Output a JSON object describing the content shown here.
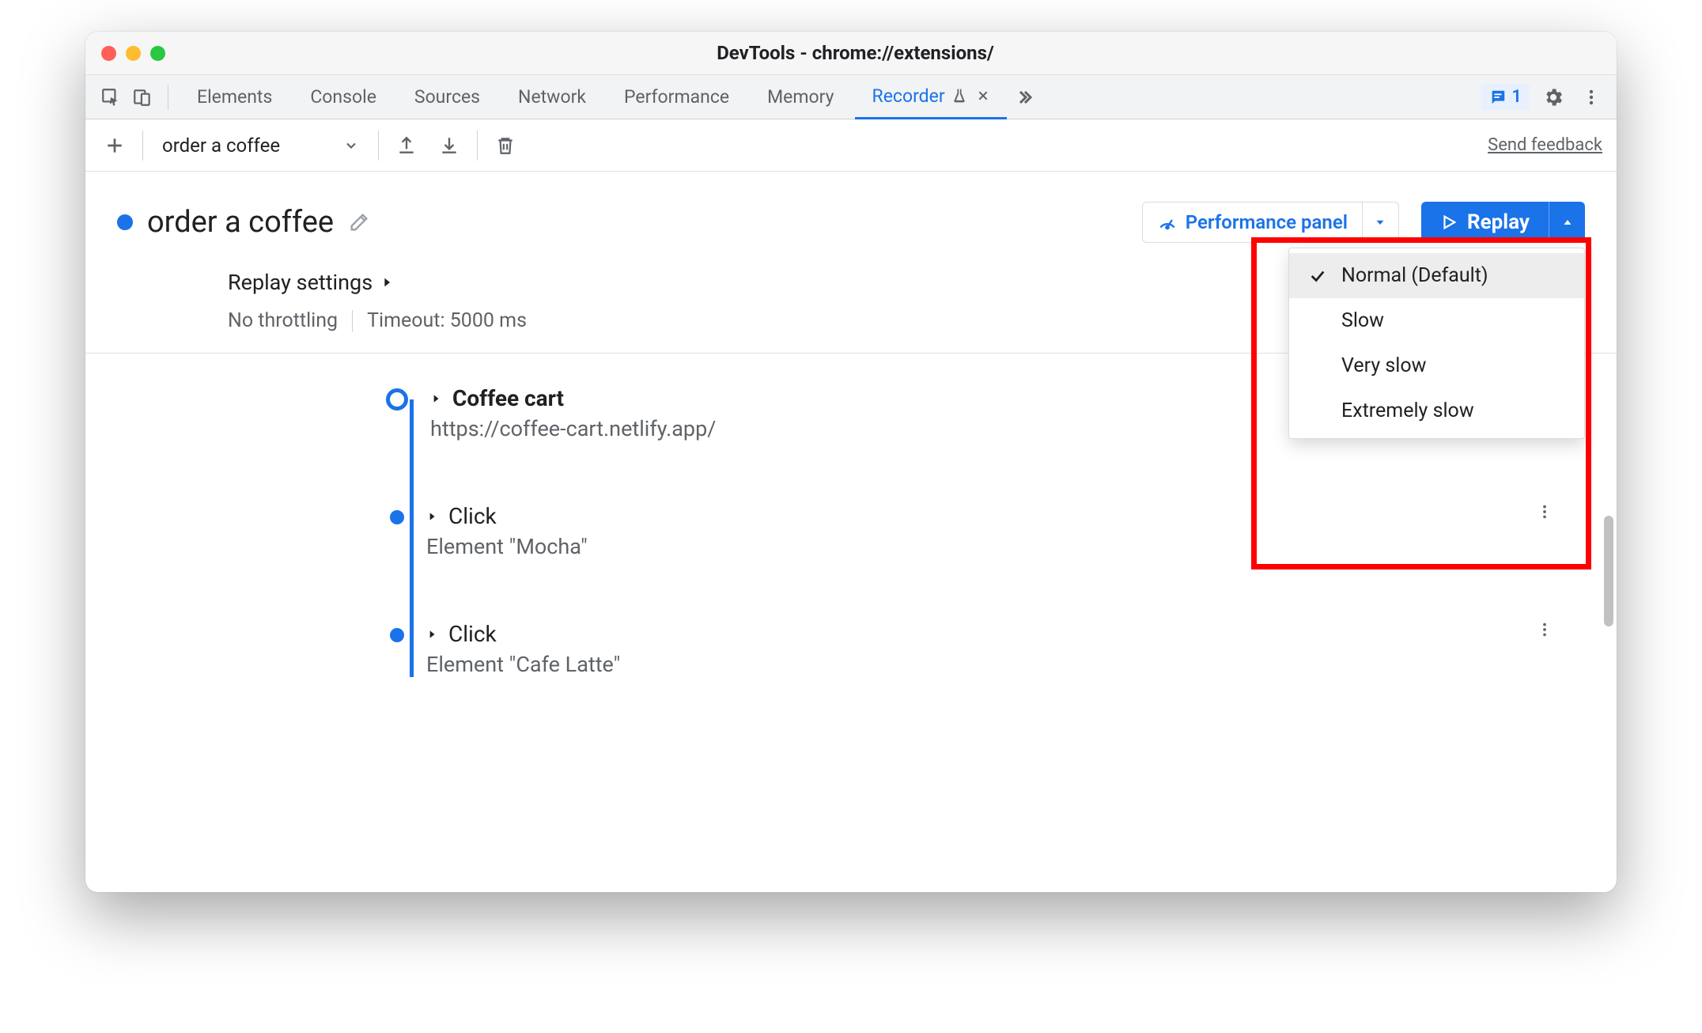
{
  "window": {
    "title": "DevTools - chrome://extensions/"
  },
  "tabs": {
    "items": [
      "Elements",
      "Console",
      "Sources",
      "Network",
      "Performance",
      "Memory",
      "Recorder"
    ],
    "active": "Recorder",
    "issues_count": "1"
  },
  "toolbar": {
    "recording_select": "order a coffee",
    "feedback": "Send feedback"
  },
  "recording": {
    "title": "order a coffee",
    "perf_panel": "Performance panel",
    "replay": "Replay"
  },
  "replay_menu": {
    "items": [
      {
        "label": "Normal (Default)",
        "selected": true
      },
      {
        "label": "Slow",
        "selected": false
      },
      {
        "label": "Very slow",
        "selected": false
      },
      {
        "label": "Extremely slow",
        "selected": false
      }
    ]
  },
  "settings": {
    "title": "Replay settings",
    "throttling": "No throttling",
    "timeout": "Timeout: 5000 ms"
  },
  "steps": [
    {
      "title": "Coffee cart",
      "sub": "https://coffee-cart.netlify.app/",
      "bold": true,
      "start": true
    },
    {
      "title": "Click",
      "sub": "Element \"Mocha\"",
      "bold": false,
      "start": false
    },
    {
      "title": "Click",
      "sub": "Element \"Cafe Latte\"",
      "bold": false,
      "start": false
    }
  ]
}
